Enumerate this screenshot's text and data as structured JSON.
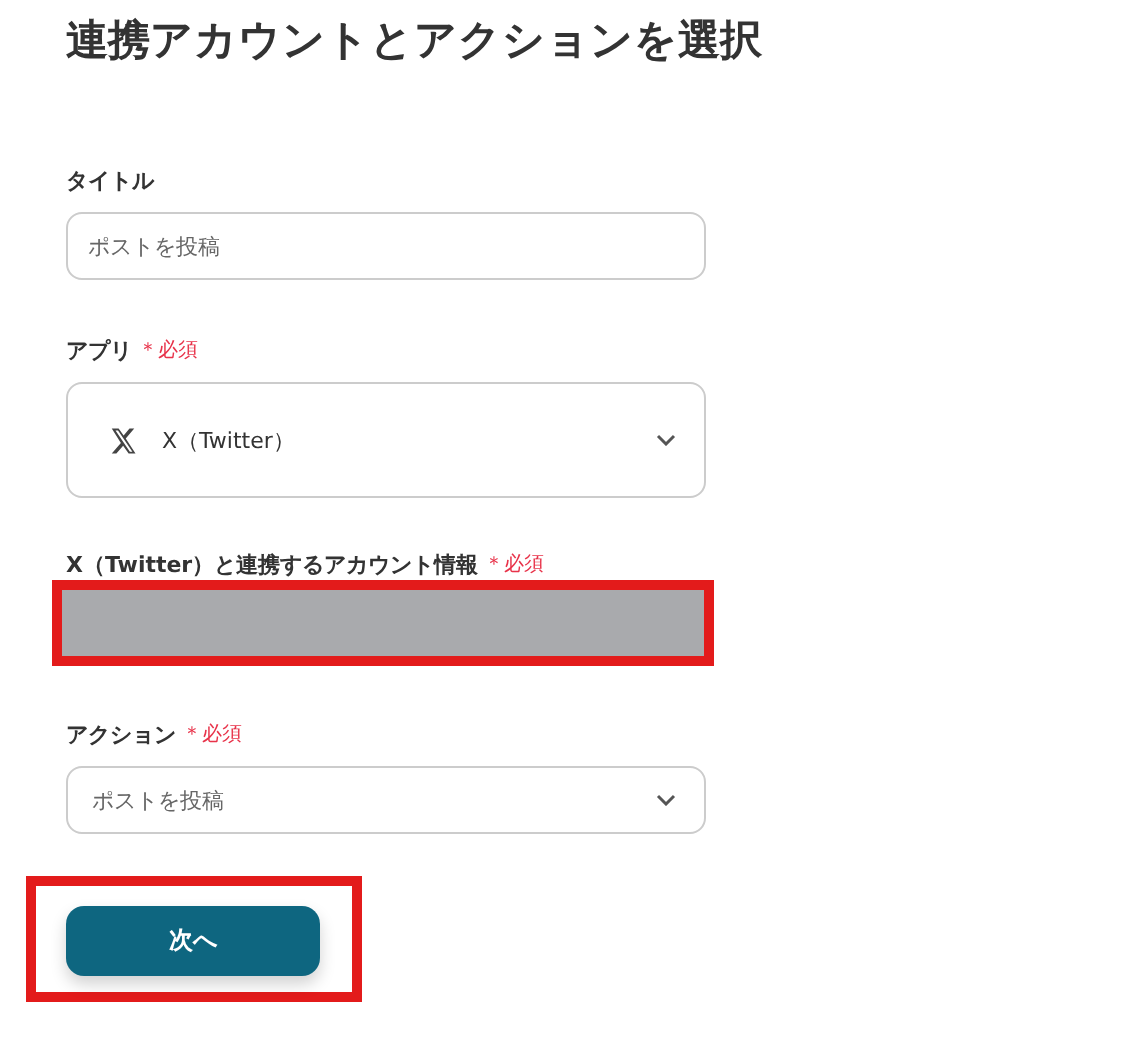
{
  "heading": "連携アカウントとアクションを選択",
  "fields": [
    {
      "kind": "text",
      "label": "タイトル",
      "value": "ポストを投稿"
    },
    {
      "kind": "app-select",
      "label": "アプリ",
      "required_label": "＊必須",
      "value": "X（Twitter）"
    },
    {
      "kind": "redacted",
      "label": "X（Twitter）と連携するアカウント情報",
      "required_label": "＊必須",
      "highlighted": true
    },
    {
      "kind": "select",
      "label": "アクション",
      "required_label": "＊必須",
      "value": "ポストを投稿"
    }
  ],
  "next_button": {
    "label": "次へ",
    "highlighted": true
  }
}
